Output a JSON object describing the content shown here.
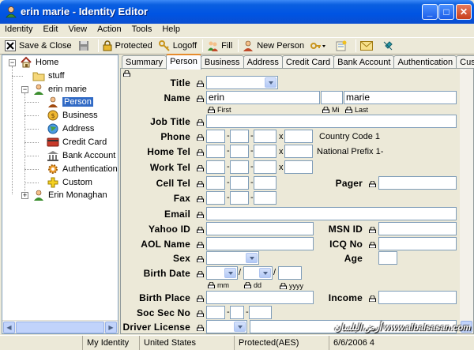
{
  "window": {
    "title": "erin marie - Identity Editor"
  },
  "menu": [
    "Identity",
    "Edit",
    "View",
    "Action",
    "Tools",
    "Help"
  ],
  "toolbar": {
    "save_close": "Save & Close",
    "protected": "Protected",
    "logoff": "Logoff",
    "fill": "Fill",
    "new_person": "New Person"
  },
  "tree": {
    "home": "Home",
    "stuff": "stuff",
    "erin_marie": "erin marie",
    "person": "Person",
    "business": "Business",
    "address": "Address",
    "credit_card": "Credit Card",
    "bank_account": "Bank Account",
    "authentication": "Authentication",
    "custom": "Custom",
    "erin_monaghan": "Erin Monaghan"
  },
  "tabs": [
    "Summary",
    "Person",
    "Business",
    "Address",
    "Credit Card",
    "Bank Account",
    "Authentication",
    "Custom"
  ],
  "form": {
    "title_label": "Title",
    "name_label": "Name",
    "first_name": "erin",
    "middle_name": "",
    "last_name": "marie",
    "first_caption": "First",
    "mi_caption": "Mi",
    "last_caption": "Last",
    "job_title_label": "Job Title",
    "phone_label": "Phone",
    "home_tel_label": "Home Tel",
    "work_tel_label": "Work Tel",
    "cell_tel_label": "Cell Tel",
    "fax_label": "Fax",
    "email_label": "Email",
    "yahoo_label": "Yahoo ID",
    "aol_label": "AOL Name",
    "sex_label": "Sex",
    "birth_date_label": "Birth Date",
    "birth_place_label": "Birth Place",
    "ssn_label": "Soc Sec No",
    "driver_label": "Driver License",
    "pager_label": "Pager",
    "msn_label": "MSN ID",
    "icq_label": "ICQ No",
    "age_label": "Age",
    "income_label": "Income",
    "country_code": "Country Code 1",
    "national_prefix": "National Prefix 1-",
    "ext_x": "x",
    "mm": "mm",
    "dd": "dd",
    "yyyy": "yyyy"
  },
  "status": {
    "identity": "My Identity",
    "country": "United States",
    "protection": "Protected(AES)",
    "date": "6/6/2006 4"
  },
  "watermark": "أرض البلسان www.albalsasan.com"
}
